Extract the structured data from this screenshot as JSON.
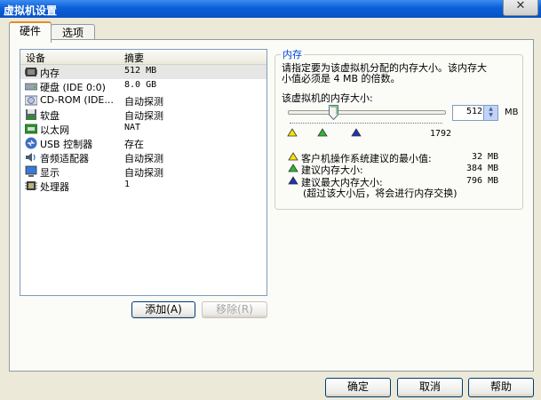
{
  "window": {
    "title": "虚拟机设置",
    "close_glyph": "✕"
  },
  "tabs": [
    {
      "label": "硬件",
      "active": true
    },
    {
      "label": "选项",
      "active": false
    }
  ],
  "device_list": {
    "col_device": "设备",
    "col_summary": "摘要",
    "rows": [
      {
        "icon": "memory-icon",
        "name": "内存",
        "summary": "512 MB",
        "selected": true
      },
      {
        "icon": "hard-disk-icon",
        "name": "硬盘 (IDE 0:0)",
        "summary": "8.0 GB"
      },
      {
        "icon": "cd-rom-icon",
        "name": "CD-ROM (IDE...",
        "summary": "自动探测"
      },
      {
        "icon": "floppy-icon",
        "name": "软盘",
        "summary": "自动探测"
      },
      {
        "icon": "network-icon",
        "name": "以太网",
        "summary": "NAT"
      },
      {
        "icon": "usb-icon",
        "name": "USB 控制器",
        "summary": "存在"
      },
      {
        "icon": "speaker-icon",
        "name": "音频适配器",
        "summary": "自动探测"
      },
      {
        "icon": "monitor-icon",
        "name": "显示",
        "summary": "自动探测"
      },
      {
        "icon": "processor-icon",
        "name": "处理器",
        "summary": "1"
      }
    ]
  },
  "buttons": {
    "add": "添加(A)",
    "remove": "移除(R)",
    "ok": "确定",
    "cancel": "取消",
    "help": "帮助"
  },
  "memory": {
    "group_title": "内存",
    "description_line1": "请指定要为该虚拟机分配的内存大小。该内存大",
    "description_line2": "小值必须是 4 MB 的倍数。",
    "size_label": "该虚拟机的内存大小:",
    "value": "512",
    "unit": "MB",
    "slider_max": "1792",
    "slider_position": 0.29,
    "legend": [
      {
        "label": "客户机操作系统建议的最小值:",
        "value": "32 MB",
        "color": "#f2e600"
      },
      {
        "label": "建议内存大小:",
        "value": "384 MB",
        "color": "#2eb82e"
      },
      {
        "label": "建议最大内存大小:",
        "value": "796 MB",
        "color": "#1f33b8"
      }
    ],
    "legend_note": "(超过该大小后，将会进行内存交换)"
  }
}
